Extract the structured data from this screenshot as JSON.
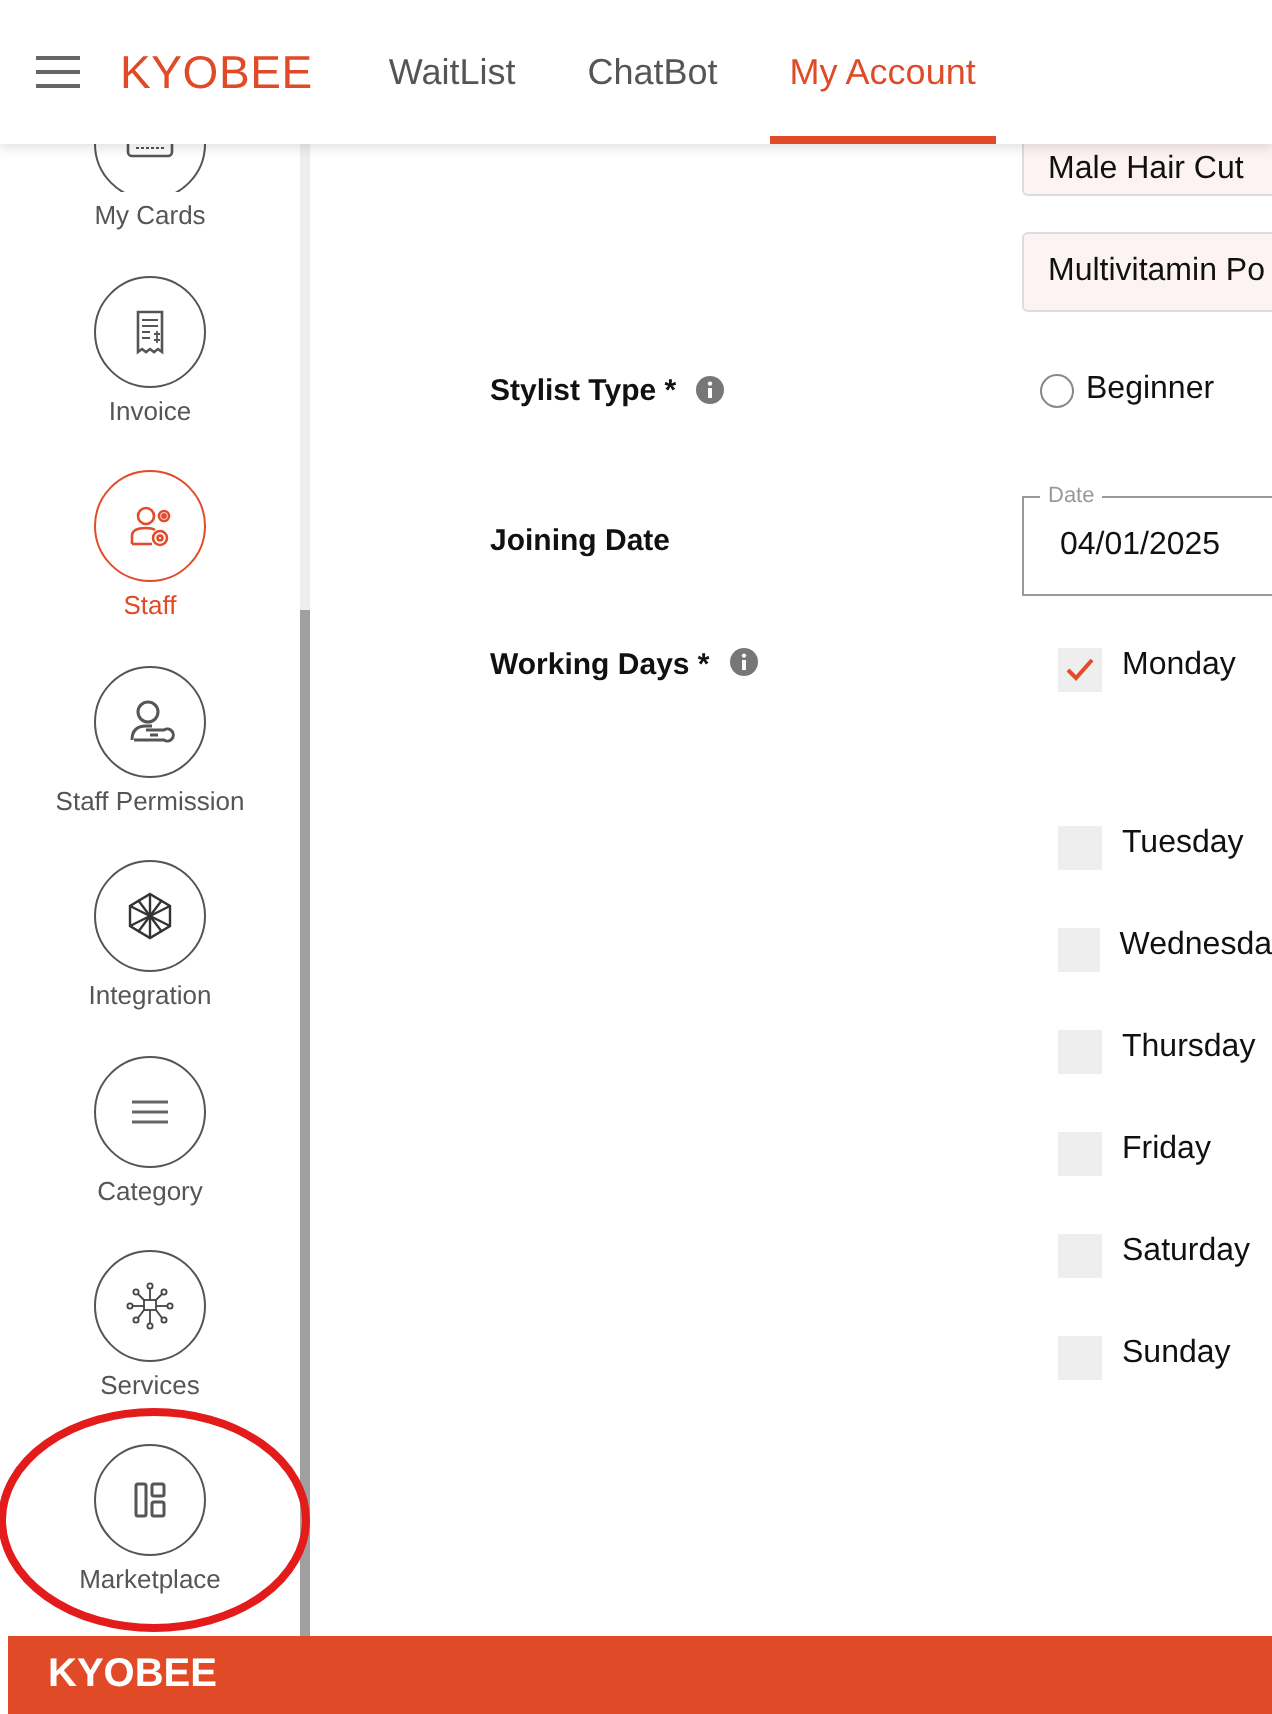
{
  "header": {
    "brand": "KYOBEE",
    "tabs": [
      {
        "label": "WaitList",
        "selected": false
      },
      {
        "label": "ChatBot",
        "selected": false
      },
      {
        "label": "My Account",
        "selected": true
      }
    ]
  },
  "sidebar": {
    "items": [
      {
        "label": "My Cards",
        "kind": "partial",
        "selected": false
      },
      {
        "label": "Invoice",
        "kind": "full",
        "selected": false
      },
      {
        "label": "Staff",
        "kind": "full",
        "selected": true
      },
      {
        "label": "Staff Permission",
        "kind": "full",
        "selected": false
      },
      {
        "label": "Integration",
        "kind": "full",
        "selected": false
      },
      {
        "label": "Category",
        "kind": "full",
        "selected": false
      },
      {
        "label": "Services",
        "kind": "full",
        "selected": false
      },
      {
        "label": "Marketplace",
        "kind": "full",
        "selected": false,
        "circled": true
      }
    ]
  },
  "form": {
    "services": {
      "values": [
        "Male Hair Cut",
        "Multivitamin Po"
      ]
    },
    "stylist_type": {
      "label": "Stylist Type *",
      "options": [
        {
          "label": "Beginner",
          "selected": false
        }
      ]
    },
    "joining_date": {
      "label": "Joining Date",
      "field_label": "Date",
      "value": "04/01/2025"
    },
    "working_days": {
      "label": "Working Days *",
      "days": [
        {
          "label": "Monday",
          "checked": true
        },
        {
          "label": "Tuesday",
          "checked": false
        },
        {
          "label": "Wednesda",
          "checked": false
        },
        {
          "label": "Thursday",
          "checked": false
        },
        {
          "label": "Friday",
          "checked": false
        },
        {
          "label": "Saturday",
          "checked": false
        },
        {
          "label": "Sunday",
          "checked": false
        }
      ]
    }
  },
  "footer": {
    "brand": "KYOBEE"
  }
}
